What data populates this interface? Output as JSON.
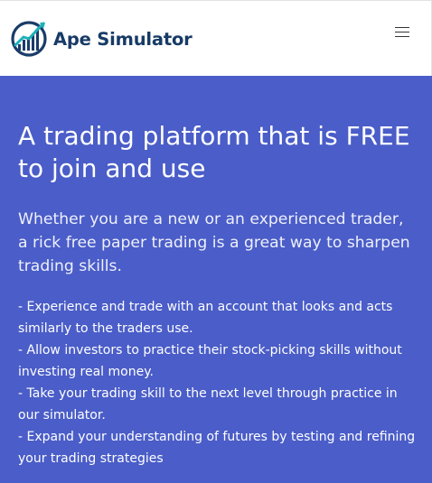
{
  "header": {
    "brand_name": "Ape Simulator",
    "logo_icon": "rising-bar-chart-logo-icon",
    "menu_icon": "hamburger-menu-icon",
    "brand_color": "#183b66",
    "logo_accent": "#1db1b9"
  },
  "hero": {
    "background_color": "#4a5dc8",
    "title": "A trading platform that is FREE to join and use",
    "lead": "Whether you are a new or an experienced trader, a rick free paper trading is a great way to sharpen trading skills.",
    "points": [
      "- Experience and trade with an account that looks and acts similarly to the traders use.",
      "- Allow investors to practice their stock-picking skills without investing real money.",
      "- Take your trading skill to the next level through practice in our simulator.",
      "- Expand your understanding of futures by testing and refining your trading strategies"
    ]
  }
}
